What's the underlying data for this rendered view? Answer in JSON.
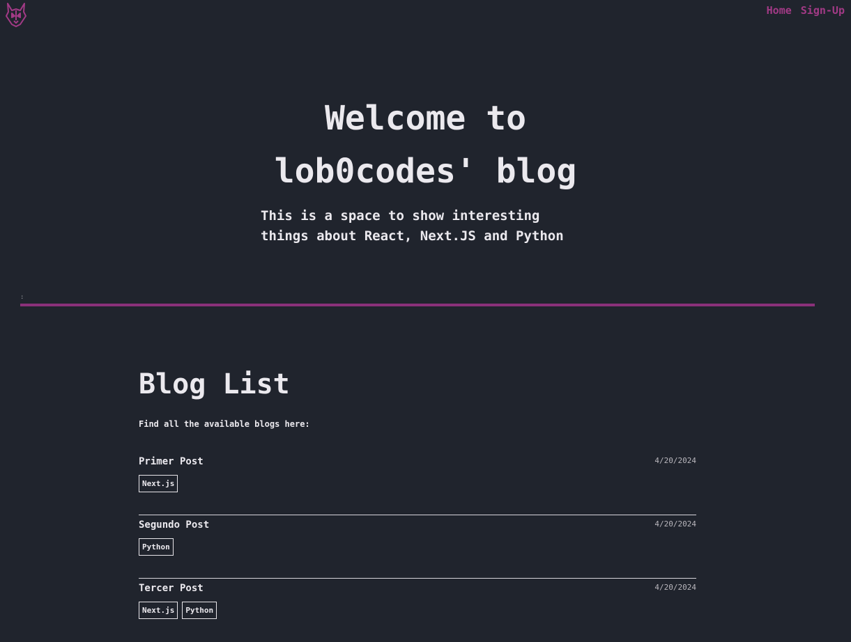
{
  "nav": {
    "logo_icon": "wolf-head-icon",
    "links": [
      "Home",
      "Sign-Up"
    ]
  },
  "hero": {
    "title": "Welcome to lob0codes' blog",
    "subtitle": "This is a space to show interesting things about React, Next.JS and Python"
  },
  "separator": {
    "mark": ":"
  },
  "blog": {
    "title": "Blog List",
    "description": "Find all the available blogs here:",
    "posts": [
      {
        "title": "Primer Post",
        "date": "4/20/2024",
        "tags": [
          "Next.js"
        ]
      },
      {
        "title": "Segundo Post",
        "date": "4/20/2024",
        "tags": [
          "Python"
        ]
      },
      {
        "title": "Tercer Post",
        "date": "4/20/2024",
        "tags": [
          "Next.js",
          "Python"
        ]
      }
    ]
  },
  "colors": {
    "background": "#20242d",
    "accent": "#a23a86",
    "divider": "#8a3079",
    "text": "#ebe9ee"
  }
}
